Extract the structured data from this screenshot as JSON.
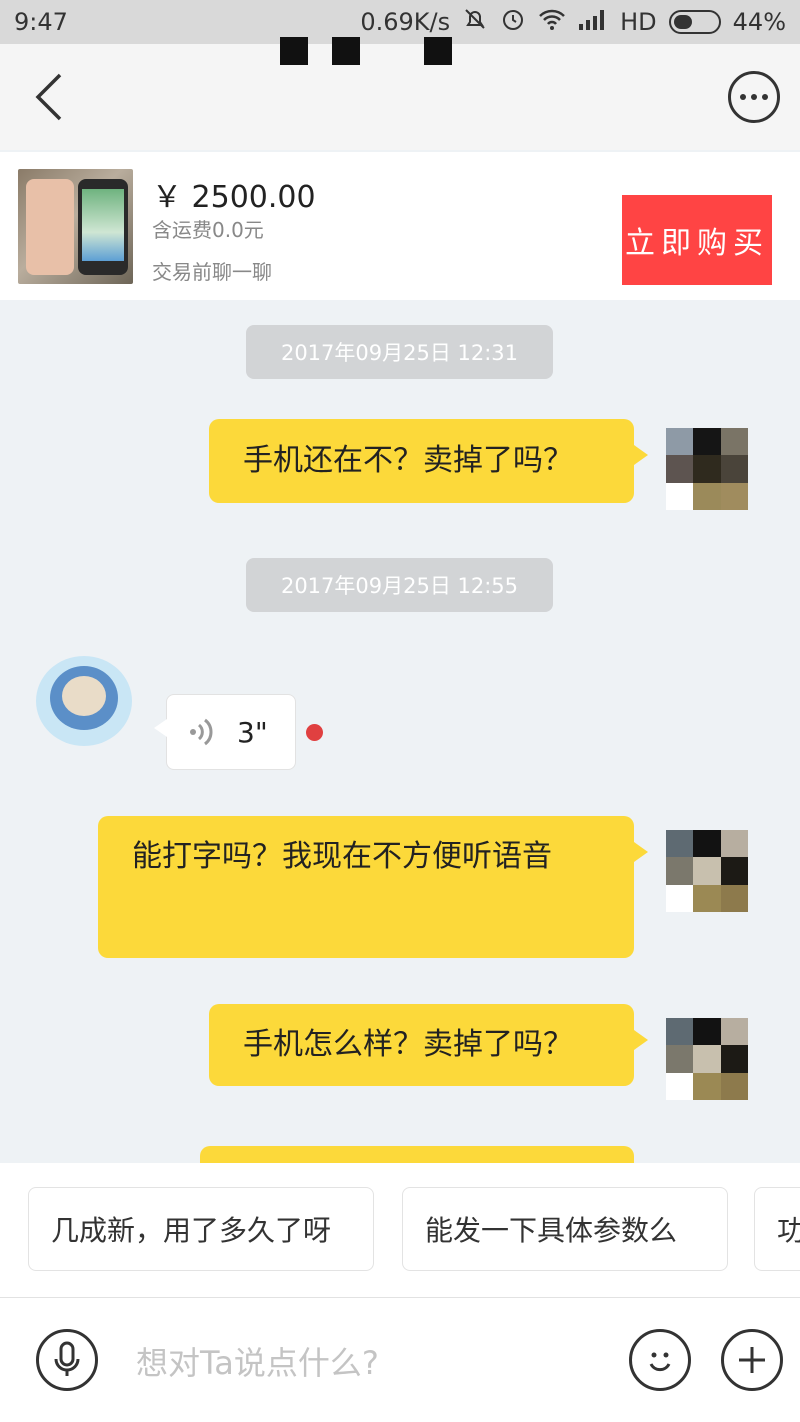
{
  "status_bar": {
    "time": "9:47",
    "net_speed": "0.69K/s",
    "network": "HD",
    "battery": "44%",
    "battery_level": 0.44
  },
  "nav": {
    "back_icon": "chevron-left-icon",
    "more_icon": "more-dots-icon"
  },
  "product": {
    "price": "￥ 2500.00",
    "shipping": "含运费0.0元",
    "chat_before": "交易前聊一聊",
    "buy_label": "立即购买"
  },
  "chat": {
    "timestamps": [
      "2017年09月25日 12:31",
      "2017年09月25日 12:55"
    ],
    "messages": [
      "手机还在不？卖掉了吗？",
      "能打字吗？我现在不方便听语音",
      "手机怎么样？卖掉了吗？"
    ],
    "voice_duration": "3\""
  },
  "suggestions": [
    "几成新，用了多久了呀",
    "能发一下具体参数么",
    "功"
  ],
  "input": {
    "placeholder": "想对Ta说点什么?",
    "voice_icon": "microphone-icon",
    "emoji_icon": "smiley-icon",
    "plus_icon": "plus-icon"
  },
  "colors": {
    "bubble": "#fcd93a",
    "buy_button": "#ff4444",
    "unread": "#e04040"
  }
}
